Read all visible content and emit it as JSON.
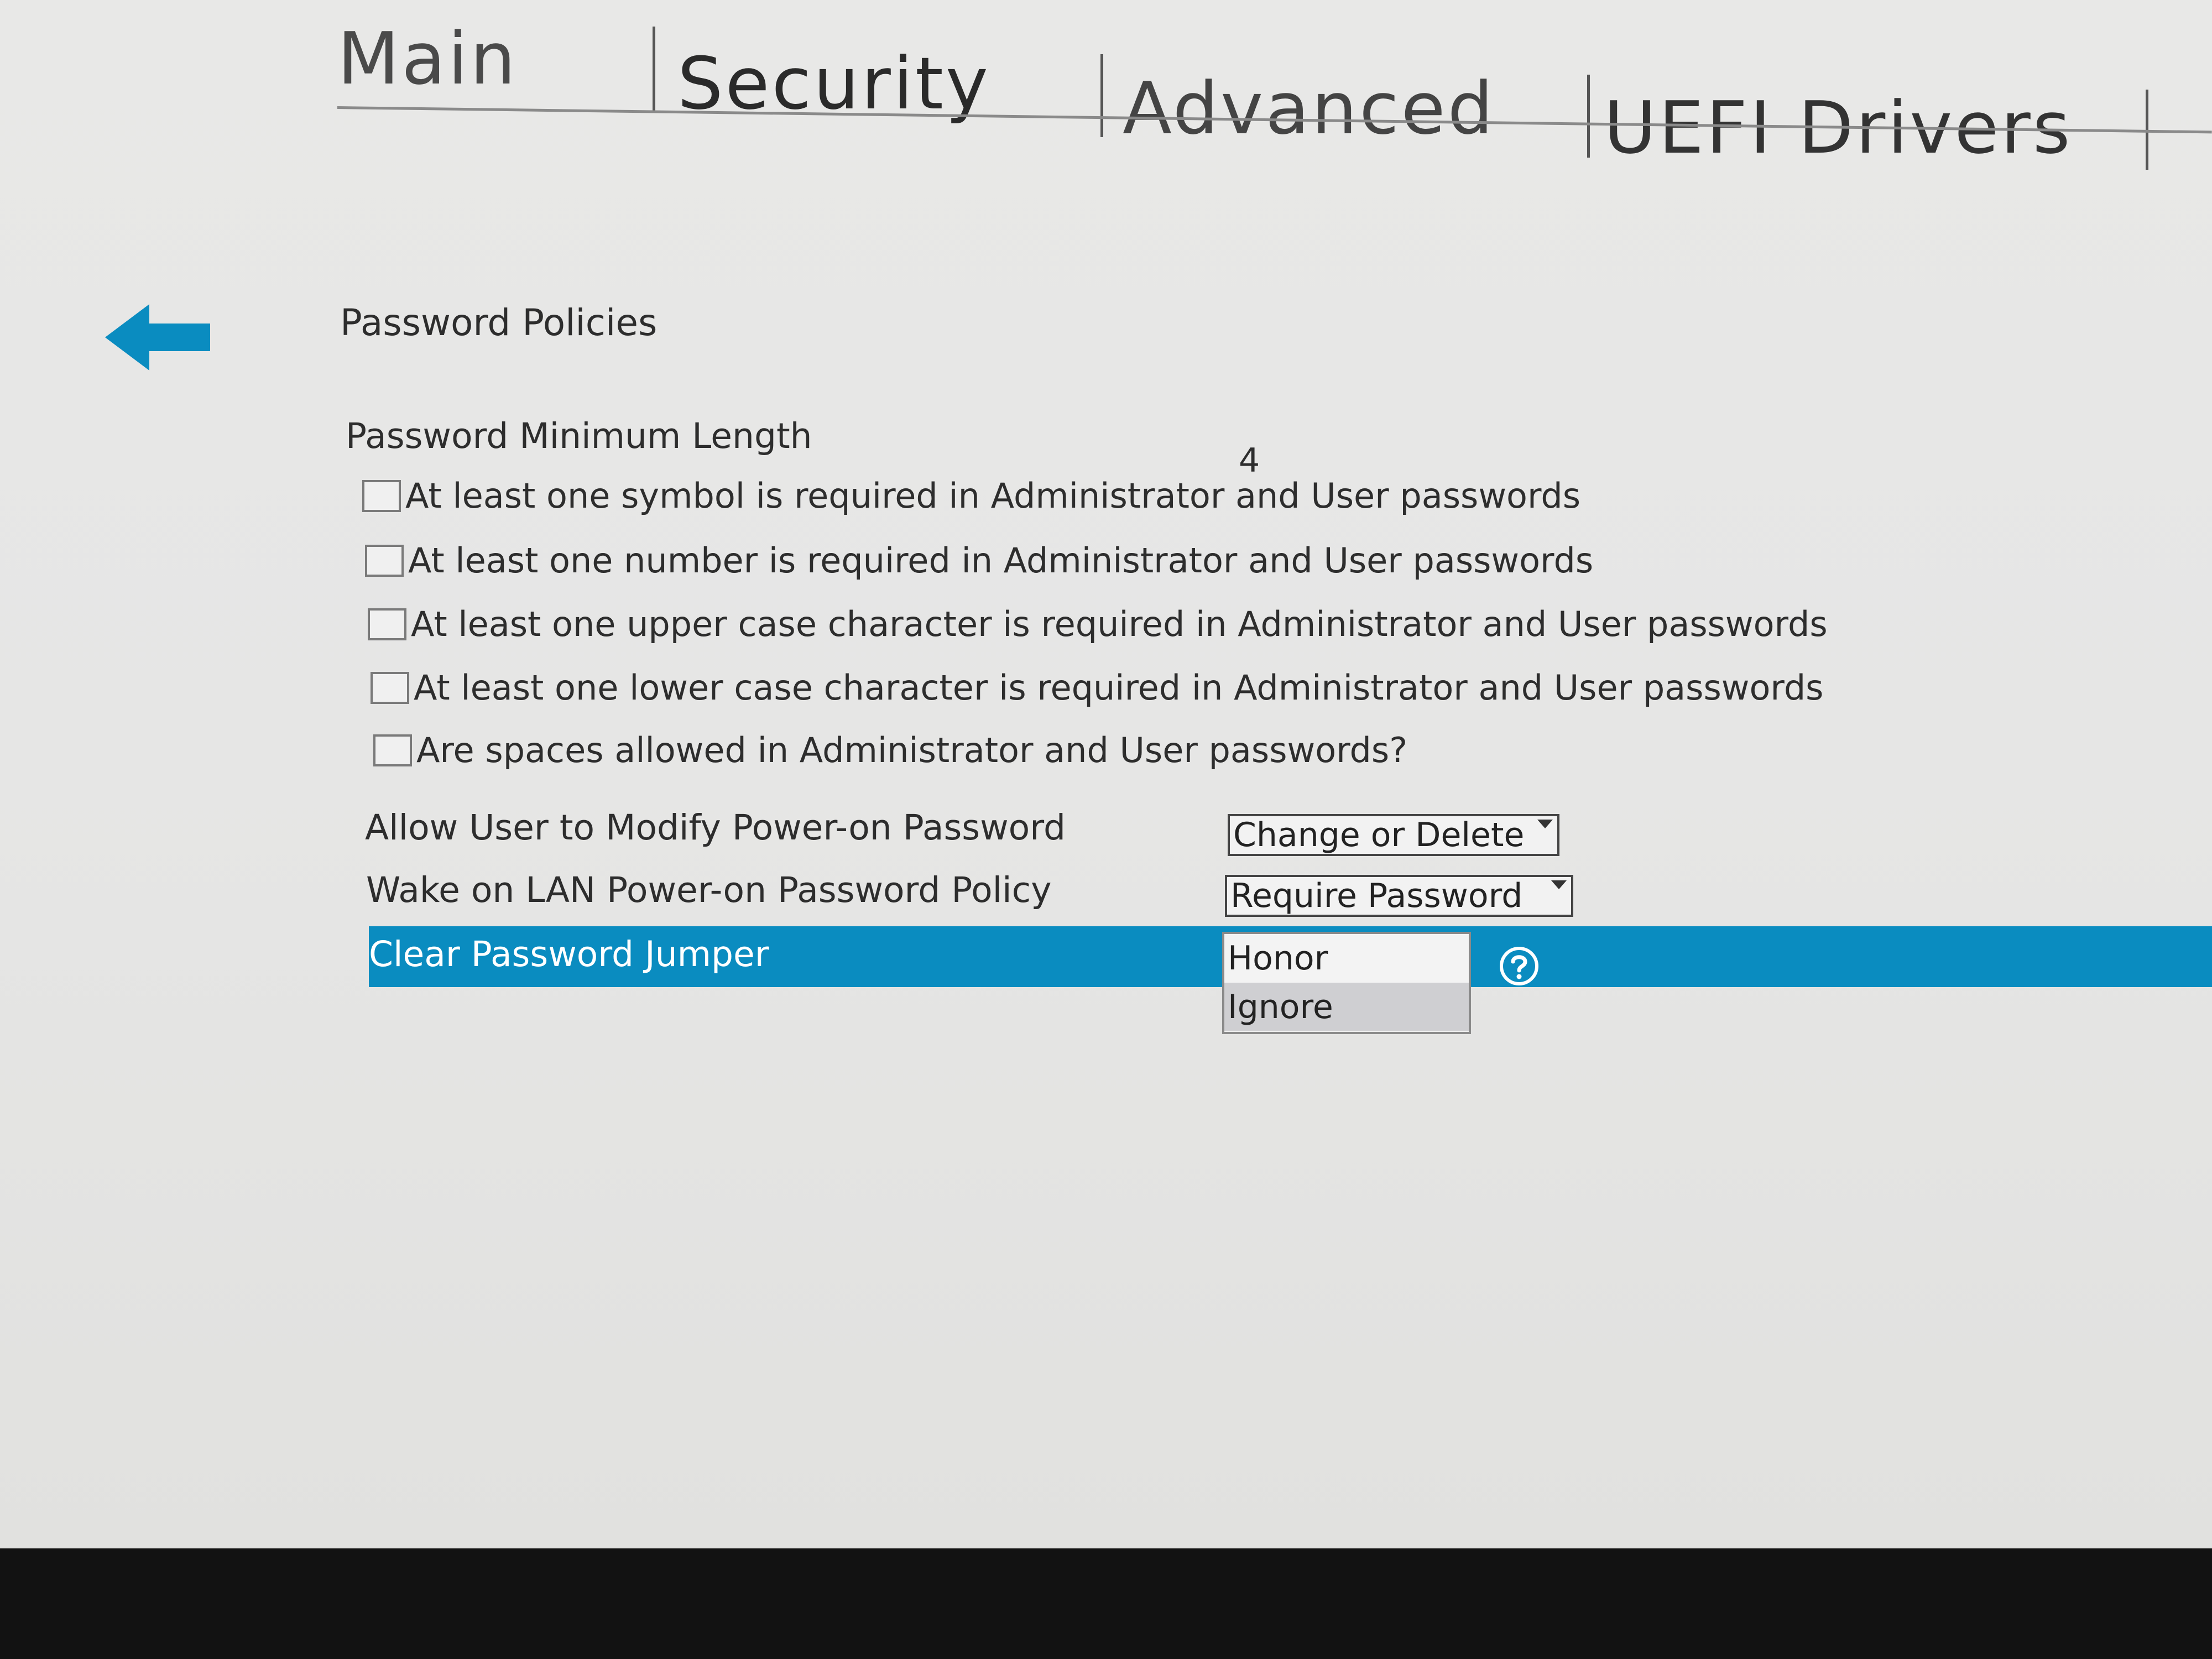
{
  "tabs": [
    {
      "label": "Main"
    },
    {
      "label": "Security"
    },
    {
      "label": "Advanced"
    },
    {
      "label": "UEFI Drivers"
    }
  ],
  "page": {
    "title": "Password Policies"
  },
  "min_length": {
    "label": "Password Minimum Length",
    "value": "4"
  },
  "checkboxes": [
    {
      "label": "At least one symbol is required in Administrator and User passwords",
      "checked": false
    },
    {
      "label": "At least one number is required in Administrator and User passwords",
      "checked": false
    },
    {
      "label": "At least one upper case character is required in Administrator and User passwords",
      "checked": false
    },
    {
      "label": "At least one lower case character is required in Administrator and User passwords",
      "checked": false
    },
    {
      "label": "Are spaces allowed in Administrator and User passwords?",
      "checked": false
    }
  ],
  "modify_password": {
    "label": "Allow User to Modify Power-on Password",
    "value": "Change or Delete"
  },
  "wol_policy": {
    "label": "Wake on LAN Power-on Password Policy",
    "value": "Require Password"
  },
  "clear_jumper": {
    "label": "Clear Password Jumper",
    "options": [
      "Honor",
      "Ignore"
    ]
  },
  "icons": {
    "back": "arrow-left-icon",
    "help": "help-icon"
  },
  "colors": {
    "accent": "#0a8cc0",
    "background": "#e6e6e5",
    "bezel": "#121212"
  }
}
